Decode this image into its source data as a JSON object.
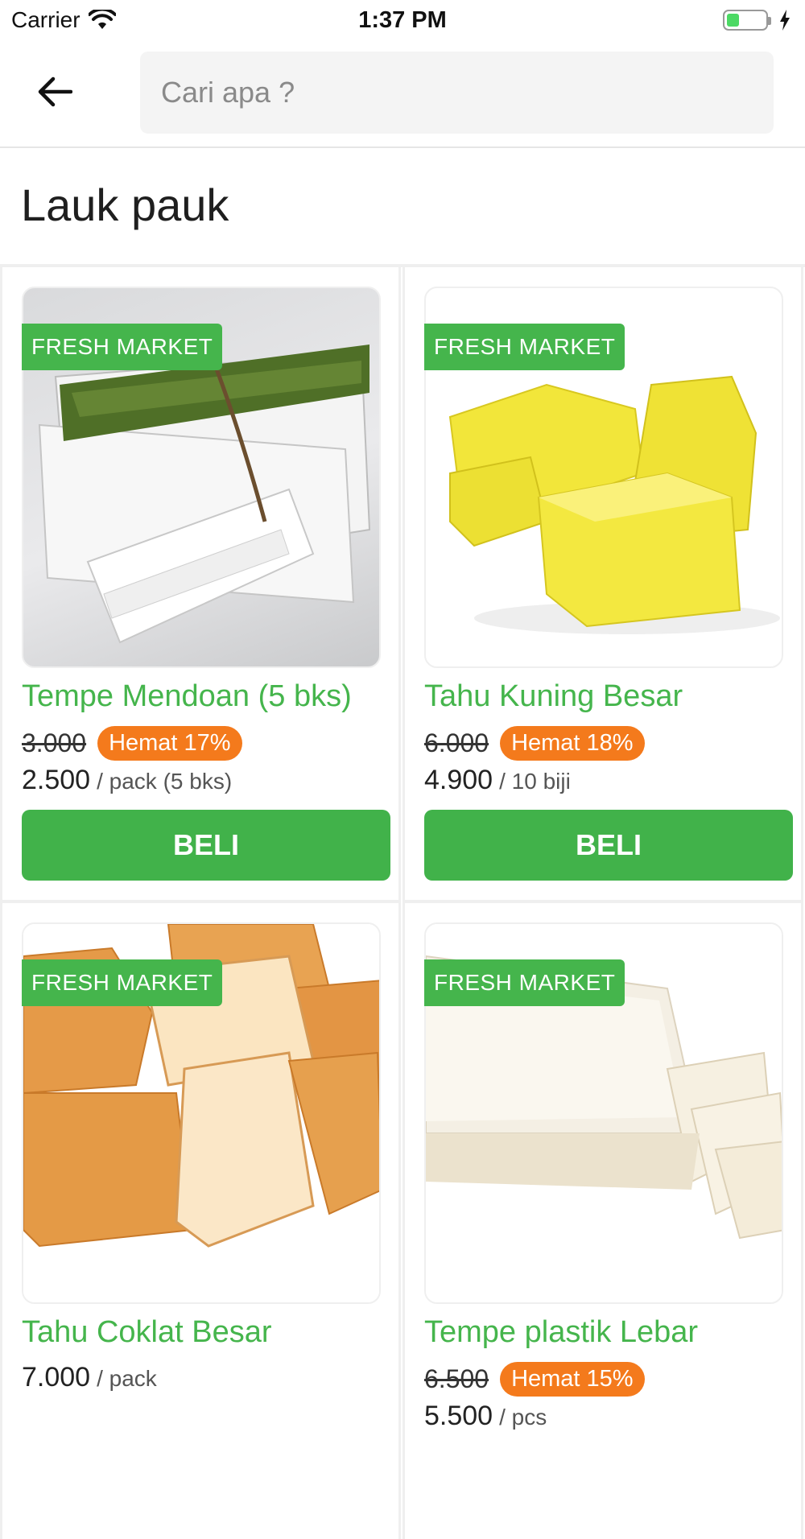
{
  "status": {
    "carrier": "Carrier",
    "time": "1:37 PM"
  },
  "header": {
    "search_placeholder": "Cari apa ?"
  },
  "category": {
    "title": "Lauk pauk"
  },
  "products": [
    {
      "badge": "FRESH MARKET",
      "name": "Tempe Mendoan (5 bks)",
      "old_price": "3.000",
      "discount": "Hemat 17%",
      "price": "2.500",
      "unit": "/ pack (5 bks)",
      "buy_label": "BELI"
    },
    {
      "badge": "FRESH MARKET",
      "name": "Tahu Kuning Besar",
      "old_price": "6.000",
      "discount": "Hemat 18%",
      "price": "4.900",
      "unit": "/ 10 biji",
      "buy_label": "BELI"
    },
    {
      "badge": "FRESH MARKET",
      "name": "Tahu Coklat Besar",
      "price": "7.000",
      "unit": "/ pack"
    },
    {
      "badge": "FRESH MARKET",
      "name": "Tempe plastik Lebar",
      "old_price": "6.500",
      "discount": "Hemat 15%",
      "price": "5.500",
      "unit": "/ pcs"
    }
  ],
  "colors": {
    "brand_green": "#45b54c",
    "discount_orange": "#f47a1c"
  }
}
